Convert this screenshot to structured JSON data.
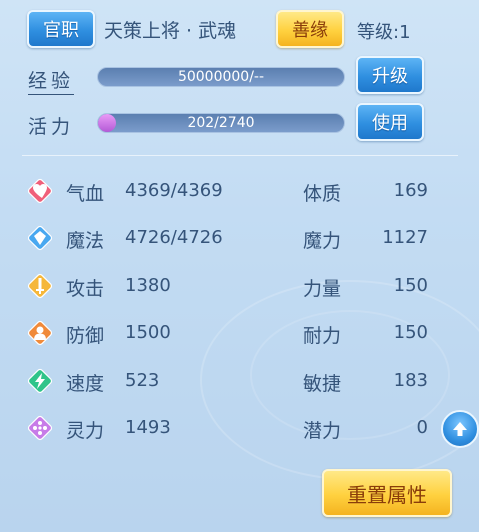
{
  "header": {
    "office_button": "官职",
    "title": "天策上将 · 武魂",
    "karma_button": "善缘",
    "level_label": "等级:",
    "level_value": "1"
  },
  "exp": {
    "label": "经验",
    "value_text": "50000000/--",
    "fill": 0,
    "button": "升级"
  },
  "vitality": {
    "label": "活力",
    "value_text": "202/2740",
    "fill": 0.074,
    "button": "使用"
  },
  "stats_left": [
    {
      "name": "气血",
      "value": "4369/4369",
      "icon": "heart-icon",
      "color": "#f0607a"
    },
    {
      "name": "魔法",
      "value": "4726/4726",
      "icon": "mana-gem-icon",
      "color": "#49a8f0"
    },
    {
      "name": "攻击",
      "value": "1380",
      "icon": "sword-icon",
      "color": "#f5b73a"
    },
    {
      "name": "防御",
      "value": "1500",
      "icon": "shield-icon",
      "color": "#f08a3a"
    },
    {
      "name": "速度",
      "value": "523",
      "icon": "lightning-icon",
      "color": "#2fc48a"
    },
    {
      "name": "灵力",
      "value": "1493",
      "icon": "spirit-icon",
      "color": "#c77be8"
    }
  ],
  "stats_right": [
    {
      "name": "体质",
      "value": "169"
    },
    {
      "name": "魔力",
      "value": "1127"
    },
    {
      "name": "力量",
      "value": "150"
    },
    {
      "name": "耐力",
      "value": "150"
    },
    {
      "name": "敏捷",
      "value": "183"
    },
    {
      "name": "潜力",
      "value": "0"
    }
  ],
  "reset_button": "重置属性",
  "colors": {
    "blue_button": "#2f8fe0",
    "gold_button": "#ffd13f",
    "text": "#35547a",
    "background": "#c3dcf3"
  }
}
